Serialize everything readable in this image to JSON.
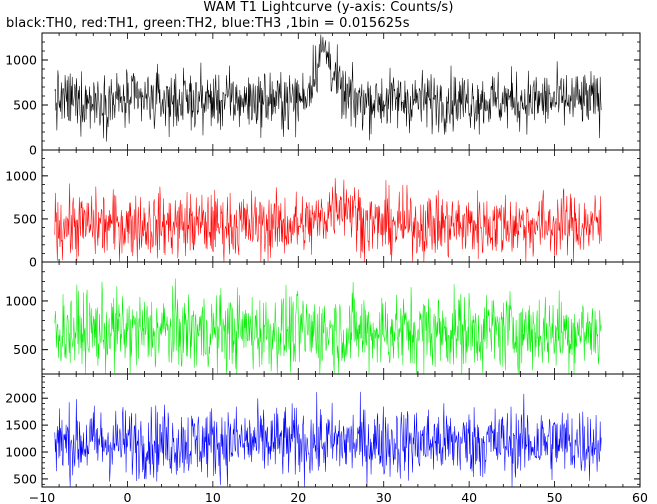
{
  "title": "WAM T1 Lightcurve (y-axis: Counts/s)",
  "subtitle": "black:TH0, red:TH1, green:TH2, blue:TH3 ,1bin = 0.015625s",
  "chart_data": {
    "type": "line",
    "title": "WAM T1 Lightcurve (y-axis: Counts/s)",
    "subtitle": "black:TH0, red:TH1, green:TH2, blue:TH3 ,1bin = 0.015625s",
    "xlabel": "",
    "ylabel": "",
    "xlim": [
      -10,
      60
    ],
    "x_range_data": [
      -8.5,
      55.5
    ],
    "x_ticks": [
      -10,
      0,
      10,
      20,
      30,
      40,
      50,
      60
    ],
    "x_tick_labels": [
      "−10",
      "0",
      "10",
      "20",
      "30",
      "40",
      "50",
      "60"
    ],
    "grid": false,
    "panels": [
      {
        "series_name": "TH0",
        "color": "#000000",
        "ylim": [
          0,
          1300
        ],
        "y_ticks": [
          0,
          500,
          1000
        ],
        "y_tick_labels": [
          "0",
          "500",
          "1000"
        ],
        "mean_counts": 550,
        "spread": 160,
        "feature": {
          "type": "peak",
          "x_center": 23,
          "width_s": 1.5,
          "peak_counts": 1100
        }
      },
      {
        "series_name": "TH1",
        "color": "#ff0000",
        "ylim": [
          0,
          1300
        ],
        "y_ticks": [
          0,
          500,
          1000
        ],
        "y_tick_labels": [
          "0",
          "500",
          "1000"
        ],
        "mean_counts": 430,
        "spread": 190,
        "feature": {
          "type": "bump",
          "x_center": 25,
          "width_s": 2,
          "peak_counts": 700
        }
      },
      {
        "series_name": "TH2",
        "color": "#00ee00",
        "ylim": [
          250,
          1400
        ],
        "y_ticks": [
          500,
          1000
        ],
        "y_tick_labels": [
          "500",
          "1000"
        ],
        "mean_counts": 690,
        "spread": 200,
        "feature": null
      },
      {
        "series_name": "TH3",
        "color": "#0000ff",
        "ylim": [
          350,
          2450
        ],
        "y_ticks": [
          500,
          1000,
          1500,
          2000
        ],
        "y_tick_labels": [
          "500",
          "1000",
          "1500",
          "2000"
        ],
        "mean_counts": 1180,
        "spread": 330,
        "feature": null
      }
    ]
  }
}
